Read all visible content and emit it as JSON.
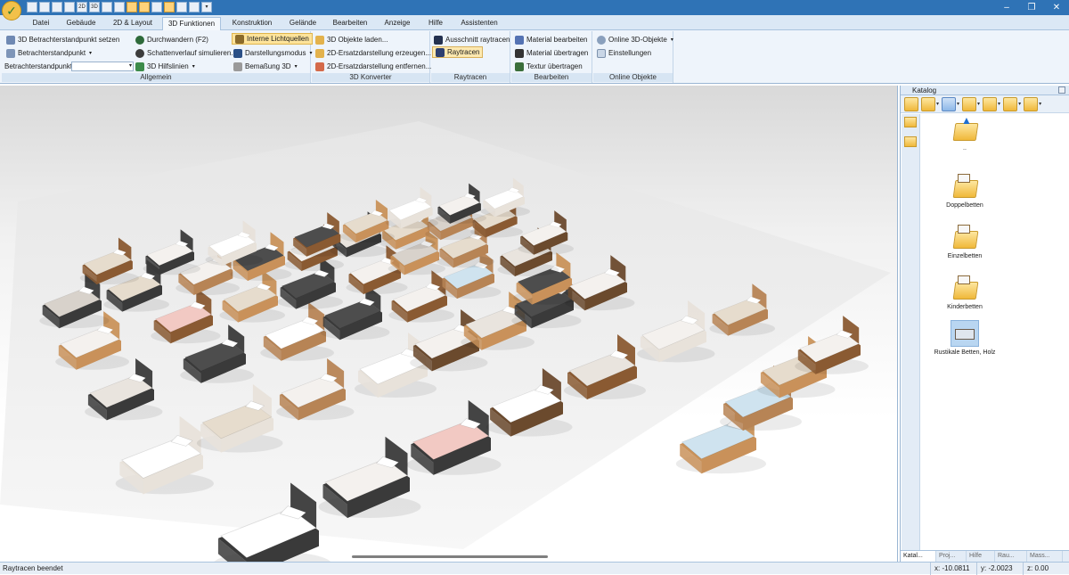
{
  "quick_access": {
    "icons": [
      "new-icon",
      "open-icon",
      "save-icon",
      "undo-icon",
      "2d-icon",
      "3d-icon",
      "print-icon",
      "grid-icon",
      "walls-icon",
      "cursor-icon",
      "render-icon",
      "select-icon",
      "move-icon",
      "copy-icon",
      "dropdown-icon"
    ],
    "labels": {
      "2d": "2D",
      "3d": "3D"
    }
  },
  "tabs": [
    "Datei",
    "Gebäude",
    "2D & Layout",
    "3D Funktionen",
    "Konstruktion",
    "Gelände",
    "Bearbeiten",
    "Anzeige",
    "Hilfe",
    "Assistenten"
  ],
  "active_tab": "3D Funktionen",
  "ribbon": {
    "allgemein": {
      "label": "Allgemein",
      "betrachter_setzen": "3D Betrachterstandpunkt setzen",
      "betrachterstandpunkt": "Betrachterstandpunkt",
      "betrachterstandpunkt_label": "Betrachterstandpunkt",
      "durchwandern": "Durchwandern (F2)",
      "schattenverlauf": "Schattenverlauf simulieren...",
      "hilfslinien": "3D Hilfslinien",
      "interne_lichtquellen": "Interne Lichtquellen",
      "darstellungsmodus": "Darstellungsmodus",
      "bemassung": "Bemaßung 3D"
    },
    "konverter": {
      "label": "3D Konverter",
      "objekte_laden": "3D Objekte laden...",
      "ersatz_erzeugen": "2D-Ersatzdarstellung erzeugen...",
      "ersatz_entfernen": "2D-Ersatzdarstellung entfernen..."
    },
    "raytracen": {
      "label": "Raytracen",
      "ausschnitt": "Ausschnitt raytracen",
      "raytracen": "Raytracen"
    },
    "bearbeiten": {
      "label": "Bearbeiten",
      "material_bearbeiten": "Material bearbeiten",
      "material_uebertragen": "Material übertragen",
      "textur_uebertragen": "Textur übertragen"
    },
    "online": {
      "label": "Online Objekte",
      "online_3d": "Online 3D-Objekte",
      "einstellungen": "Einstellungen"
    }
  },
  "catalog": {
    "title": "Katalog",
    "items": [
      {
        "label": "..",
        "icon": "folder-up-icon"
      },
      {
        "label": "Doppelbetten",
        "icon": "folder-icon"
      },
      {
        "label": "Einzelbetten",
        "icon": "folder-icon"
      },
      {
        "label": "Kinderbetten",
        "icon": "folder-icon"
      },
      {
        "label": "Rustikale Betten, Holz",
        "icon": "bed-object-icon"
      }
    ],
    "bottom_tabs": [
      "Katal...",
      "Proj...",
      "Hilfe",
      "Rau...",
      "Mass..."
    ]
  },
  "status": {
    "message": "Raytracen beendet",
    "x": "x: -10.0811",
    "y": "y: -2.0023",
    "z": "z: 0.00"
  },
  "colors": {
    "titlebar": "#2f73b6",
    "ribbon": "#eef4fb",
    "highlight": "#fde39a",
    "accent_wood": "#c9925a",
    "fabric_pink": "#f0c4c0"
  }
}
